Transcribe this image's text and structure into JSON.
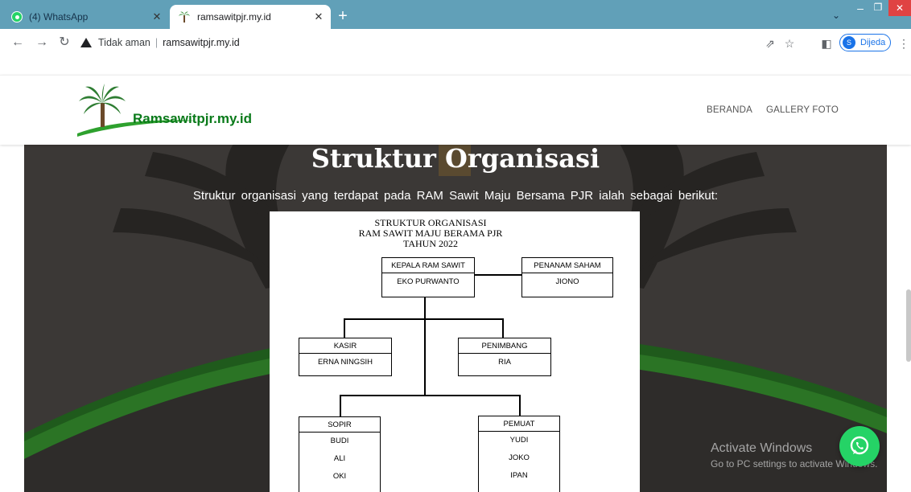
{
  "browser": {
    "tabs": [
      {
        "title": "(4) WhatsApp",
        "close": "✕",
        "active": false
      },
      {
        "title": "ramsawitpjr.my.id",
        "close": "✕",
        "active": true
      }
    ],
    "new_tab": "+",
    "window": {
      "minimize": "–",
      "maximize": "❐",
      "close": "✕"
    },
    "security_label": "Tidak aman",
    "url": "ramsawitpjr.my.id",
    "profile_initial": "S",
    "profile_label": "Dijeda"
  },
  "site": {
    "brand": "Ramsawitpjr.my.id",
    "menu": [
      "BERANDA",
      "GALLERY FOTO"
    ]
  },
  "hero": {
    "title": "Struktur Organisasi",
    "subtitle": "Struktur organisasi yang terdapat pada RAM Sawit Maju Bersama PJR ialah sebagai berikut:"
  },
  "org_chart": {
    "heading": [
      "STRUKTUR ORGANISASI",
      "RAM SAWIT MAJU BERAMA PJR",
      "TAHUN 2022"
    ],
    "kepala": {
      "role": "KEPALA RAM SAWIT",
      "names": [
        "EKO PURWANTO"
      ]
    },
    "penanam": {
      "role": "PENANAM SAHAM",
      "names": [
        "JIONO"
      ]
    },
    "kasir": {
      "role": "KASIR",
      "names": [
        "ERNA NINGSIH"
      ]
    },
    "penimbang": {
      "role": "PENIMBANG",
      "names": [
        "RIA"
      ]
    },
    "sopir": {
      "role": "SOPIR",
      "names": [
        "BUDI",
        "ALI",
        "OKI"
      ]
    },
    "pemuat": {
      "role": "PEMUAT",
      "names": [
        "YUDI",
        "JOKO",
        "IPAN"
      ]
    }
  },
  "overlay": {
    "activate_title": "Activate Windows",
    "activate_sub": "Go to PC settings to activate Windows."
  },
  "colors": {
    "tabbar": "#61a0b8",
    "brand_green": "#0a7a1a",
    "whatsapp_green": "#25d366",
    "hero_bg": "#3b3836"
  }
}
